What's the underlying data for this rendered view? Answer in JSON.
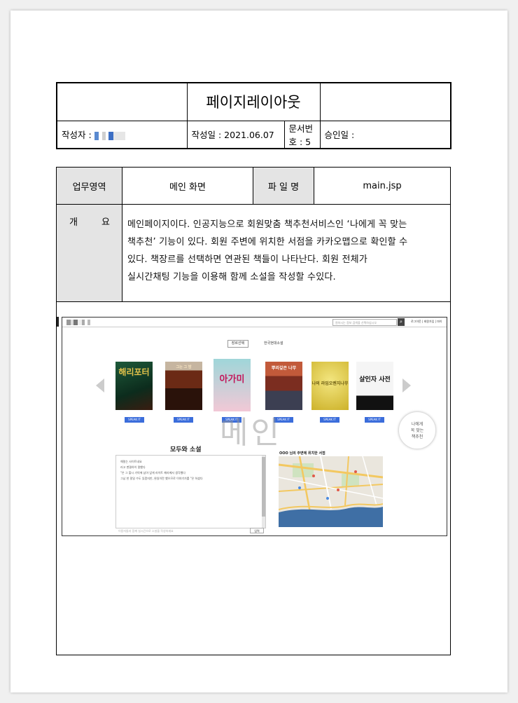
{
  "document": {
    "title": "페이지레이아웃",
    "author_label": "작성자 :",
    "date_label": "작성일 :",
    "date_value": "2021.06.07",
    "doc_no_label": "문서번호 :",
    "doc_no_value": "5",
    "approval_label": "승인일 :"
  },
  "info": {
    "area_label": "업무영역",
    "area_value": "메인 화면",
    "file_label": "파 일 명",
    "file_value": "main.jsp",
    "overview_label_1": "개",
    "overview_label_2": "요",
    "overview_lines": [
      "메인페이지이다. 인공지능으로 회원맞춤 책추천서비스인 ‘나에게 꼭 맞는",
      "책추천’ 기능이 있다. 회원 주변에 위치한 서점을 카카오맵으로 확인할 수",
      "있다. 책장르를 선택하면 연관된 책들이 나타난다. 회원 전체가",
      "실시간채팅 기능을 이용해 함께 소설을 작성할 수있다."
    ]
  },
  "mockup": {
    "search_placeholder": "원하시는 정보 검색을 선택하십시오",
    "top_links": "로그아웃 | 회원가입 | 마이",
    "tab_active": "장르선택",
    "tab_genre": "한국현대소설",
    "books": [
      {
        "title": "해리포터",
        "bg": "#1e5a3a",
        "fg": "#e2c14a",
        "btn": "SPEAK IT"
      },
      {
        "title": "그는 그 밤",
        "bg": "#8a3a1f",
        "fg": "#f5e3c0",
        "btn": "SPEAK IT"
      },
      {
        "title": "아가미",
        "bg": "#9fd6d9",
        "fg": "#c2185b",
        "btn": "SPEAK IT"
      },
      {
        "title": "뿌리깊은 나무",
        "bg": "#c25a3a",
        "fg": "#ffffff",
        "btn": "SPEAK IT"
      },
      {
        "title": "나의 라임오렌지나무",
        "bg": "#e8d64a",
        "fg": "#6a5a10",
        "btn": "SPEAK IT"
      },
      {
        "title": "살인자 사전",
        "bg": "#f2f2f2",
        "fg": "#111111",
        "btn": "SPEAK IT"
      }
    ],
    "rec_text": [
      "나에게",
      "꼭 맞는",
      "책추천"
    ],
    "watermark": "메인",
    "chat_title": "모두와 소설",
    "chat_lines": [
      "해럴는 사이트네요",
      "러고 맨결하이 말했다",
      "\"은 그 할시 기억에 남아 앉게 라이트 께라께서 생각했다",
      "그남 한 말일 수도 있겠지만, 완일이란 했으므로 이야기가를 \"은 하셨다"
    ],
    "chat_input": "이용자들과 함께 실시간으로 소설을 작성하세요",
    "send": "입력",
    "map_title": "OOO 님의 주변에 위치한 서점",
    "colors": {
      "accent": "#3b6ddb",
      "river": "#3f6fa5"
    }
  }
}
